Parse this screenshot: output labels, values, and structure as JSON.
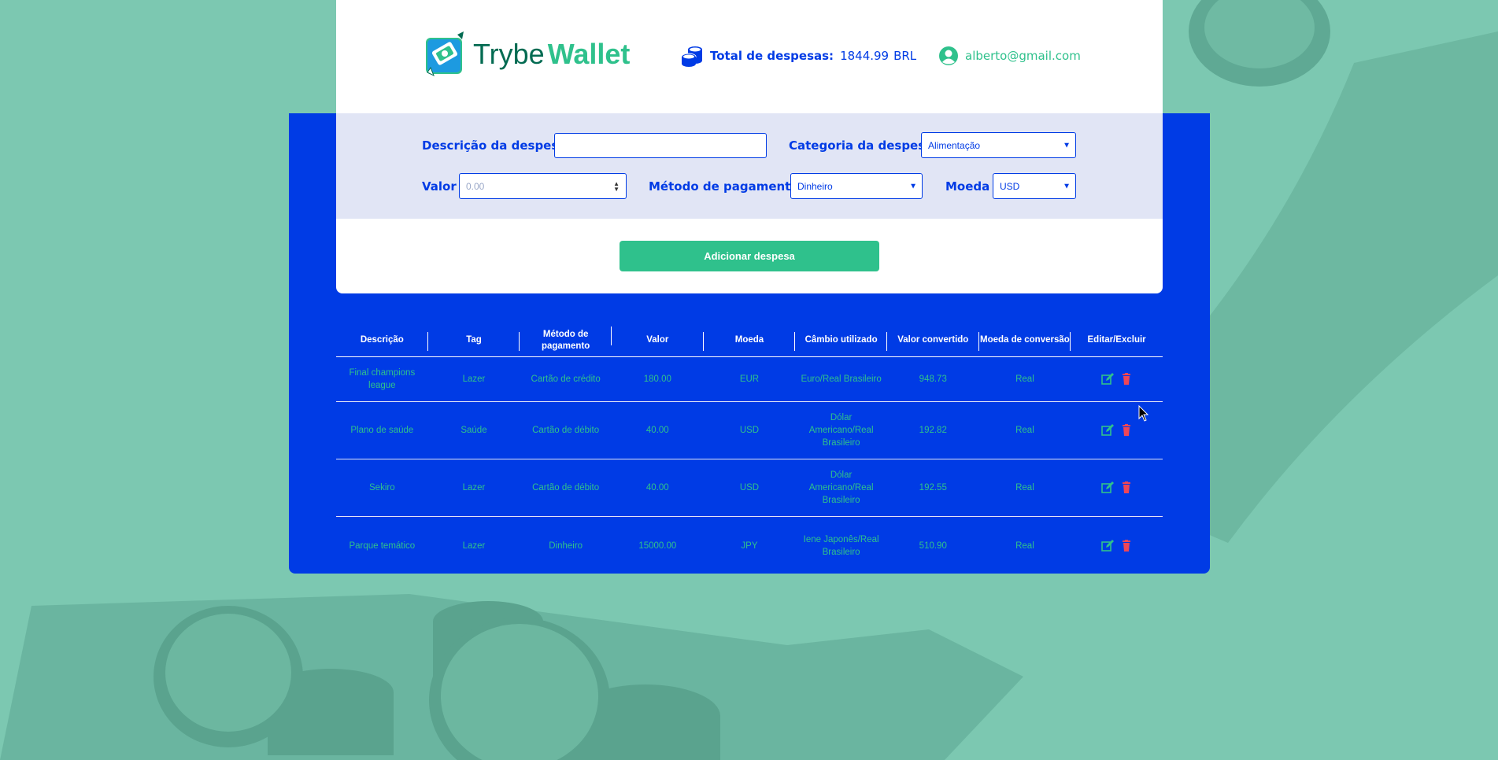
{
  "header": {
    "logo_trybe": "Trybe",
    "logo_wallet": "Wallet",
    "total_label": "Total de despesas:",
    "total_value": "1844.99",
    "total_currency": "BRL",
    "user_email": "alberto@gmail.com"
  },
  "form": {
    "description_label": "Descrição da despesa",
    "description_value": "",
    "category_label": "Categoria da despesa",
    "category_value": "Alimentação",
    "value_label": "Valor",
    "value_placeholder": "0.00",
    "method_label": "Método de pagamento",
    "method_value": "Dinheiro",
    "currency_label": "Moeda",
    "currency_value": "USD",
    "add_button": "Adicionar despesa"
  },
  "table": {
    "headers": [
      "Descrição",
      "Tag",
      "Método de pagamento",
      "Valor",
      "Moeda",
      "Câmbio utilizado",
      "Valor convertido",
      "Moeda de conversão",
      "Editar/Excluir"
    ],
    "rows": [
      [
        "Final champions league",
        "Lazer",
        "Cartão de crédito",
        "180.00",
        "EUR",
        "Euro/Real Brasileiro",
        "948.73",
        "Real"
      ],
      [
        "Plano de saúde",
        "Saúde",
        "Cartão de débito",
        "40.00",
        "USD",
        "Dólar Americano/Real Brasileiro",
        "192.82",
        "Real"
      ],
      [
        "Sekiro",
        "Lazer",
        "Cartão de débito",
        "40.00",
        "USD",
        "Dólar Americano/Real Brasileiro",
        "192.55",
        "Real"
      ],
      [
        "Parque temático",
        "Lazer",
        "Dinheiro",
        "15000.00",
        "JPY",
        "Iene Japonês/Real Brasileiro",
        "510.90",
        "Real"
      ]
    ]
  },
  "icons": {
    "edit": "edit-icon",
    "delete": "trash-icon",
    "coins": "coins-icon",
    "user": "user-icon"
  },
  "colors": {
    "primary_blue": "#003be5",
    "green": "#2fc18c",
    "dark_green": "#036b52",
    "delete_red": "#ee4658",
    "background": "#7cc8b1"
  }
}
